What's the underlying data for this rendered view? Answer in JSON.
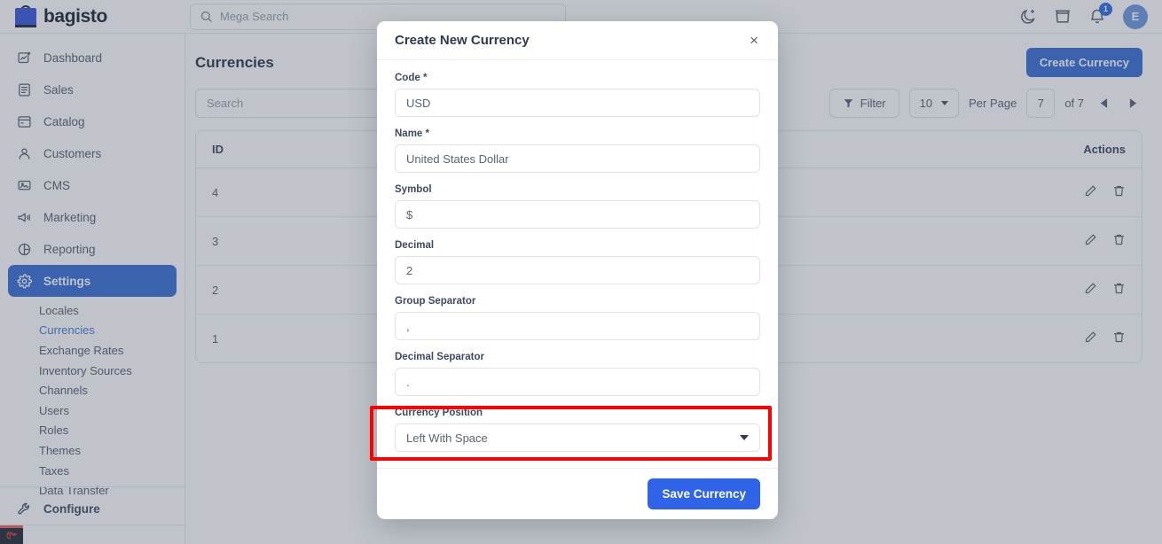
{
  "topbar": {
    "brand": "bagisto",
    "search_placeholder": "Mega Search",
    "search_value": "",
    "notification_count": "1",
    "avatar_initial": "E",
    "icons": {
      "theme": "moon-icon",
      "store": "store-icon",
      "bell": "bell-icon"
    }
  },
  "sidebar": {
    "items": [
      {
        "label": "Dashboard",
        "icon": "dashboard-icon"
      },
      {
        "label": "Sales",
        "icon": "sales-icon"
      },
      {
        "label": "Catalog",
        "icon": "catalog-icon"
      },
      {
        "label": "Customers",
        "icon": "customers-icon"
      },
      {
        "label": "CMS",
        "icon": "cms-icon"
      },
      {
        "label": "Marketing",
        "icon": "marketing-icon"
      },
      {
        "label": "Reporting",
        "icon": "reporting-icon"
      },
      {
        "label": "Settings",
        "icon": "gear-icon"
      }
    ],
    "settings_children": [
      "Locales",
      "Currencies",
      "Exchange Rates",
      "Inventory Sources",
      "Channels",
      "Users",
      "Roles",
      "Themes",
      "Taxes",
      "Data Transfer"
    ],
    "active_item": "Settings",
    "current_child": "Currencies",
    "bottom_item": {
      "label": "Configure",
      "icon": "wrench-icon"
    }
  },
  "page": {
    "title": "Currencies",
    "create_button": "Create Currency",
    "search_placeholder": "Search",
    "search_value": "",
    "filter_button": "Filter",
    "per_page_value": "10",
    "per_page_label": "Per Page",
    "current_page": "7",
    "total_pages_label": "of 7"
  },
  "table": {
    "columns": [
      "ID",
      "Actions"
    ],
    "rows": [
      {
        "id": "4"
      },
      {
        "id": "3"
      },
      {
        "id": "2"
      },
      {
        "id": "1"
      }
    ],
    "row_action_icons": [
      "pencil-icon",
      "trash-icon"
    ]
  },
  "modal": {
    "title": "Create New Currency",
    "close_label": "×",
    "fields": [
      {
        "label": "Code *",
        "value": "USD",
        "type": "text"
      },
      {
        "label": "Name *",
        "value": "United States Dollar",
        "type": "text"
      },
      {
        "label": "Symbol",
        "value": "$",
        "type": "text"
      },
      {
        "label": "Decimal",
        "value": "2",
        "type": "text"
      },
      {
        "label": "Group Separator",
        "value": ",",
        "type": "text"
      },
      {
        "label": "Decimal Separator",
        "value": ".",
        "type": "text"
      },
      {
        "label": "Currency Position",
        "value": "Left With Space",
        "type": "select"
      }
    ],
    "save_button": "Save Currency"
  },
  "annotation": {
    "highlight_color": "#ff0000",
    "target": "Currency Position"
  },
  "colors": {
    "brand_blue": "#3b6fd4",
    "save_blue": "#2f64e8",
    "link_blue": "#4a7bd8",
    "text": "#5a6474",
    "heading": "#2f3a4f"
  }
}
